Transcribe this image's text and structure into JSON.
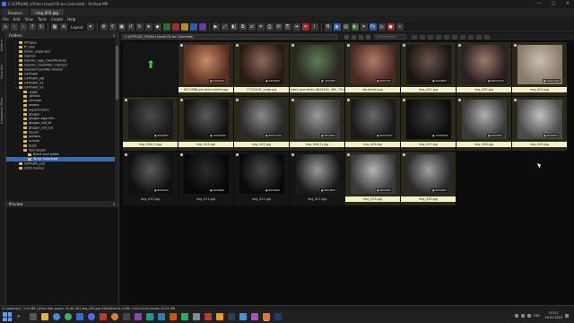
{
  "window": {
    "title": "C:\\GFPGAN_V3\\Yeni klasör\\To be Colorized\\ - XnView MP",
    "min": "—",
    "max": "▢",
    "close": "✕"
  },
  "tabs": [
    {
      "label": "Browser"
    },
    {
      "label": "img_003.jpg"
    }
  ],
  "menu": [
    "File",
    "Edit",
    "View",
    "Tools",
    "Create",
    "Help"
  ],
  "toolbar": {
    "layout_label": "Layout"
  },
  "left_strip": [
    "Folders",
    "Favorites",
    "Categories Filter"
  ],
  "folders_panel": {
    "title": "Folders",
    "items": [
      {
        "label": "Ffmpeg",
        "depth": 2,
        "arrow": "›"
      },
      {
        "label": "ff_utils",
        "depth": 2,
        "arrow": "›"
      },
      {
        "label": "folder_organizer",
        "depth": 2,
        "arrow": "›"
      },
      {
        "label": "Games",
        "depth": 2,
        "arrow": "›"
      },
      {
        "label": "Gender_age_Classification",
        "depth": 2,
        "arrow": "›"
      },
      {
        "label": "Gender_Classifier_Classico",
        "depth": 2,
        "arrow": "›"
      },
      {
        "label": "GenderClassifier-master",
        "depth": 2,
        "arrow": "›"
      },
      {
        "label": "GFPGAN",
        "depth": 2,
        "arrow": "›"
      },
      {
        "label": "GFPGAN_old",
        "depth": 2,
        "arrow": "›"
      },
      {
        "label": "GFPGAN_V2",
        "depth": 2,
        "arrow": "›"
      },
      {
        "label": "GFPGAN_V3",
        "depth": 2,
        "arrow": "⌄"
      },
      {
        "label": ".eggs",
        "depth": 3,
        "arrow": "›"
      },
      {
        "label": ".github",
        "depth": 3,
        "arrow": ""
      },
      {
        "label": "cmcode",
        "depth": 3,
        "arrow": ""
      },
      {
        "label": "assets",
        "depth": 3,
        "arrow": ""
      },
      {
        "label": "experiments",
        "depth": 3,
        "arrow": "›"
      },
      {
        "label": "gfpgan",
        "depth": 3,
        "arrow": "›"
      },
      {
        "label": "gfpgan.egg-info",
        "depth": 3,
        "arrow": ""
      },
      {
        "label": "gfpgan_old_bt",
        "depth": 3,
        "arrow": ""
      },
      {
        "label": "gfpgan_old_out",
        "depth": 3,
        "arrow": "›"
      },
      {
        "label": "inputs",
        "depth": 3,
        "arrow": "›"
      },
      {
        "label": "options",
        "depth": 3,
        "arrow": ""
      },
      {
        "label": "scripts",
        "depth": 3,
        "arrow": ""
      },
      {
        "label": "tests",
        "depth": 3,
        "arrow": "›"
      },
      {
        "label": "Yeni klasör",
        "depth": 3,
        "arrow": "⌄"
      },
      {
        "label": "Black and white",
        "depth": 4,
        "arrow": ""
      },
      {
        "label": "To be Colorized",
        "depth": 4,
        "arrow": "",
        "selected": true
      },
      {
        "label": "GFPGAN_zod",
        "depth": 2,
        "arrow": "›"
      },
      {
        "label": "GOD-Games",
        "depth": 2,
        "arrow": "›"
      }
    ]
  },
  "preview_panel": {
    "title": "Preview"
  },
  "address": {
    "path": "C:\\GFPGAN_V3\\Yeni klasör\\To be Colorized\\",
    "search_placeholder": "Quick search"
  },
  "thumbnails": [
    {
      "name": "",
      "meta": "",
      "kind": "up"
    },
    {
      "name": "6472568-girl-black-white.jpg",
      "meta": "▣ 540x640",
      "tone": [
        "#c98b6a",
        "#5a3020"
      ],
      "sel": true
    },
    {
      "name": "77721431_large.jpg",
      "meta": "▣ 640x960",
      "tone": [
        "#8a6a5a",
        "#2a1a14"
      ],
      "sel": true
    },
    {
      "name": "black-and-white-4824632_960_720",
      "meta": "▣ 720x480",
      "tone": [
        "#5f7a55",
        "#2a2a22"
      ],
      "sel": true
    },
    {
      "name": "db-mirzai.jpg",
      "meta": "▣ 600x750",
      "tone": [
        "#b07a6a",
        "#4a2a24"
      ],
      "sel": true
    },
    {
      "name": "img_001.jpg",
      "meta": "▣ 600x800",
      "tone": [
        "#6a5448",
        "#1a1412"
      ],
      "sel": true
    },
    {
      "name": "img_002.jpg",
      "meta": "▣ 800x1000",
      "tone": [
        "#9a7a6a",
        "#2a2024"
      ],
      "sel": true
    },
    {
      "name": "img_003.jpg",
      "meta": "▣ 736x1104",
      "tone": [
        "#c8bfae",
        "#8a7a6a"
      ],
      "sel": true
    },
    {
      "name": "img_004(1).jpg",
      "meta": "▣ 600x800",
      "tone": [
        "#4a4a4a",
        "#1a1a1a"
      ],
      "sel": true
    },
    {
      "name": "img_004.jpg",
      "meta": "▣ 1000x800",
      "tone": [
        "#5a5a5a",
        "#141414"
      ],
      "sel": true
    },
    {
      "name": "img_005.jpg",
      "meta": "▣ 800x1200",
      "tone": [
        "#8a8a8a",
        "#2a2a2a"
      ],
      "sel": true
    },
    {
      "name": "img_006(1).jpg",
      "meta": "▣ 800x600",
      "tone": [
        "#9a9a9a",
        "#3a3a3a"
      ],
      "sel": true
    },
    {
      "name": "img_006.jpg",
      "meta": "▣ 800x1000",
      "tone": [
        "#6a6a6a",
        "#1a1a1a"
      ],
      "sel": true
    },
    {
      "name": "img_007.jpg",
      "meta": "▣ 1000x800",
      "tone": [
        "#3a3a3a",
        "#0e0e0e"
      ],
      "sel": true
    },
    {
      "name": "img_008.jpg",
      "meta": "▣ 600x800",
      "tone": [
        "#b0b0b0",
        "#3a3a3a"
      ],
      "sel": true
    },
    {
      "name": "img_009.jpg",
      "meta": "▣ 600x800",
      "tone": [
        "#c0c0c0",
        "#4a4a4a"
      ],
      "sel": true
    },
    {
      "name": "img_010.jpg",
      "meta": "▣ 600x900",
      "tone": [
        "#5a5a5a",
        "#101010"
      ],
      "sel": false
    },
    {
      "name": "img_011.jpg",
      "meta": "▣ 600x800",
      "tone": [
        "#2a2a2a",
        "#080808"
      ],
      "sel": false
    },
    {
      "name": "img_012.jpg",
      "meta": "▣ 600x800",
      "tone": [
        "#4a4a4a",
        "#0a0a0a"
      ],
      "sel": false
    },
    {
      "name": "img_022.jpg",
      "meta": "▣ 600x800",
      "tone": [
        "#9a9a9a",
        "#1a1a1a"
      ],
      "sel": false
    },
    {
      "name": "img_226.jpg",
      "meta": "▣ 800x600",
      "tone": [
        "#b5b5b5",
        "#3a3a3a"
      ],
      "sel": true
    },
    {
      "name": "img_330.jpg",
      "meta": "▣ 800x800",
      "tone": [
        "#a0a0a0",
        "#2a2a2a"
      ],
      "sel": true
    }
  ],
  "status": {
    "text": "21 object(s) [ 3.51 MB ] [Free disk space: 22.44 GB]   img_003.jpg   543x640x24 (0.85) 3.01x14.00 inches  10.29 MB"
  },
  "taskbar": {
    "lang": "TUR",
    "time": "07:11",
    "date": "20.01.2023"
  },
  "colors": {
    "accent": "#2d6bc4",
    "label_bg": "#f3f0c9",
    "up_arrow": "#3ad13a"
  }
}
